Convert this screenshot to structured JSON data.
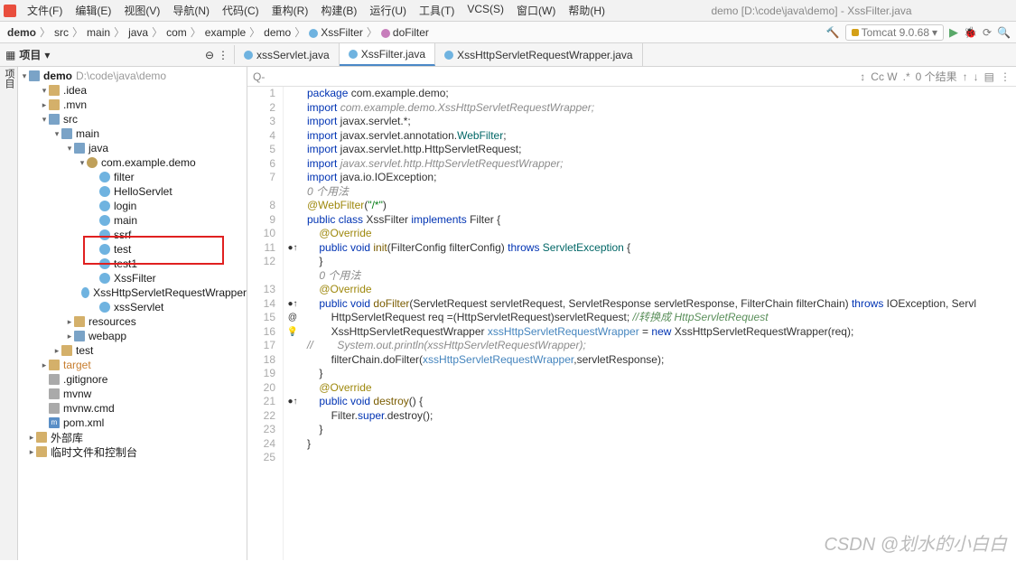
{
  "menubar": {
    "items": [
      "文件(F)",
      "编辑(E)",
      "视图(V)",
      "导航(N)",
      "代码(C)",
      "重构(R)",
      "构建(B)",
      "运行(U)",
      "工具(T)",
      "VCS(S)",
      "窗口(W)",
      "帮助(H)"
    ],
    "title": "demo [D:\\code\\java\\demo] - XssFilter.java"
  },
  "breadcrumb": {
    "parts": [
      "demo",
      "src",
      "main",
      "java",
      "com",
      "example",
      "demo",
      "XssFilter",
      "doFilter"
    ],
    "tomcat": "Tomcat 9.0.68"
  },
  "project": {
    "title": "项目",
    "root_name": "demo",
    "root_path": "D:\\code\\java\\demo",
    "tree": [
      {
        "d": 1,
        "a": "v",
        "i": "folder",
        "l": ".idea"
      },
      {
        "d": 1,
        "a": ">",
        "i": "folder",
        "l": ".mvn"
      },
      {
        "d": 1,
        "a": "v",
        "i": "folder-blue",
        "l": "src"
      },
      {
        "d": 2,
        "a": "v",
        "i": "folder-blue",
        "l": "main"
      },
      {
        "d": 3,
        "a": "v",
        "i": "folder-blue",
        "l": "java"
      },
      {
        "d": 4,
        "a": "v",
        "i": "pkg",
        "l": "com.example.demo"
      },
      {
        "d": 5,
        "a": "",
        "i": "java-c",
        "l": "filter"
      },
      {
        "d": 5,
        "a": "",
        "i": "java-c",
        "l": "HelloServlet"
      },
      {
        "d": 5,
        "a": "",
        "i": "java-c",
        "l": "login"
      },
      {
        "d": 5,
        "a": "",
        "i": "java-c",
        "l": "main"
      },
      {
        "d": 5,
        "a": "",
        "i": "java-c",
        "l": "ssrf"
      },
      {
        "d": 5,
        "a": "",
        "i": "java-c",
        "l": "test"
      },
      {
        "d": 5,
        "a": "",
        "i": "java-c",
        "l": "test1"
      },
      {
        "d": 5,
        "a": "",
        "i": "java-c",
        "l": "XssFilter"
      },
      {
        "d": 5,
        "a": "",
        "i": "java-c",
        "l": "XssHttpServletRequestWrapper"
      },
      {
        "d": 5,
        "a": "",
        "i": "java-c",
        "l": "xssServlet"
      },
      {
        "d": 3,
        "a": ">",
        "i": "folder",
        "l": "resources"
      },
      {
        "d": 3,
        "a": ">",
        "i": "folder-blue",
        "l": "webapp"
      },
      {
        "d": 2,
        "a": ">",
        "i": "folder",
        "l": "test"
      },
      {
        "d": 1,
        "a": ">",
        "i": "folder",
        "l": "target",
        "orange": true
      },
      {
        "d": 1,
        "a": "",
        "i": "file-g",
        "l": ".gitignore"
      },
      {
        "d": 1,
        "a": "",
        "i": "file-g",
        "l": "mvnw"
      },
      {
        "d": 1,
        "a": "",
        "i": "file-g",
        "l": "mvnw.cmd"
      },
      {
        "d": 1,
        "a": "",
        "i": "file-m",
        "l": "pom.xml"
      },
      {
        "d": 0,
        "a": ">",
        "i": "folder",
        "l": "外部库"
      },
      {
        "d": 0,
        "a": ">",
        "i": "folder",
        "l": "临时文件和控制台"
      }
    ]
  },
  "tabs": [
    {
      "label": "xssServlet.java",
      "active": false
    },
    {
      "label": "XssFilter.java",
      "active": true
    },
    {
      "label": "XssHttpServletRequestWrapper.java",
      "active": false
    }
  ],
  "editor_toolbar": {
    "search": "Q-",
    "caseW": "Cc W",
    "results": "0 个结果"
  },
  "code": {
    "lines": [
      {
        "n": 1,
        "m": "",
        "html": "<span class='kw'>package</span> com.example.demo;"
      },
      {
        "n": 2,
        "m": "",
        "html": "<span class='kw'>import</span> <span class='cmt'>com.example.demo.XssHttpServletRequestWrapper;</span>"
      },
      {
        "n": 3,
        "m": "",
        "html": "<span class='kw'>import</span> javax.servlet.*;"
      },
      {
        "n": 4,
        "m": "",
        "html": "<span class='kw'>import</span> javax.servlet.annotation.<span class='cls'>WebFilter</span>;"
      },
      {
        "n": 5,
        "m": "",
        "html": "<span class='kw'>import</span> javax.servlet.http.HttpServletRequest;"
      },
      {
        "n": 6,
        "m": "",
        "html": "<span class='kw'>import</span> <span class='cmt'>javax.servlet.http.HttpServletRequestWrapper;</span>"
      },
      {
        "n": 7,
        "m": "",
        "html": "<span class='kw'>import</span> java.io.IOException;"
      },
      {
        "n": "",
        "m": "",
        "html": "<span class='cmt'>0 个用法</span>"
      },
      {
        "n": 8,
        "m": "",
        "html": "<span class='ann'>@WebFilter</span>(<span class='str'>\"/*\"</span>)"
      },
      {
        "n": 9,
        "m": "",
        "html": "<span class='kw'>public class</span> XssFilter <span class='kw'>implements</span> Filter {"
      },
      {
        "n": 10,
        "m": "",
        "html": "    <span class='ann'>@Override</span>"
      },
      {
        "n": 11,
        "m": "●↑",
        "html": "    <span class='kw'>public void</span> <span class='method'>init</span>(FilterConfig filterConfig) <span class='kw'>throws</span> <span class='cls'>ServletException</span> {"
      },
      {
        "n": 12,
        "m": "",
        "html": "    }"
      },
      {
        "n": "",
        "m": "",
        "html": "    <span class='cmt'>0 个用法</span>"
      },
      {
        "n": 13,
        "m": "",
        "html": "    <span class='ann'>@Override</span>"
      },
      {
        "n": 14,
        "m": "●↑ @",
        "html": "    <span class='kw'>public void</span> <span class='method'>doFilter</span>(ServletRequest servletRequest, ServletResponse servletResponse, FilterChain filterChain) <span class='kw'>throws</span> IOException, Servl"
      },
      {
        "n": 15,
        "m": "",
        "html": "        HttpServletRequest req =(HttpServletRequest)servletRequest; <span class='green-cmt'>//转换成 HttpServletRequest</span>"
      },
      {
        "n": 16,
        "m": "💡",
        "html": "        XssHttpServletRequestWrapper <span class='param'>xssHttpServletRequestWrapper</span> = <span class='kw'>new</span> XssHttpServletRequestWrapper(req);"
      },
      {
        "n": 17,
        "m": "",
        "html": "<span class='cmt'>//        System.out.println(xssHttpServletRequestWrapper);</span>"
      },
      {
        "n": 18,
        "m": "",
        "html": "        filterChain.doFilter(<span class='param'>xssHttpServletRequestWrapper</span>,servletResponse);"
      },
      {
        "n": 19,
        "m": "",
        "html": "    }"
      },
      {
        "n": 20,
        "m": "",
        "html": "    <span class='ann'>@Override</span>"
      },
      {
        "n": 21,
        "m": "●↑",
        "html": "    <span class='kw'>public void</span> <span class='method'>destroy</span>() {"
      },
      {
        "n": 22,
        "m": "",
        "html": "        Filter.<span class='kw'>super</span>.destroy();"
      },
      {
        "n": 23,
        "m": "",
        "html": "    }"
      },
      {
        "n": 24,
        "m": "",
        "html": "}"
      },
      {
        "n": 25,
        "m": "",
        "html": ""
      }
    ]
  },
  "watermark": "CSDN @划水的小白白"
}
